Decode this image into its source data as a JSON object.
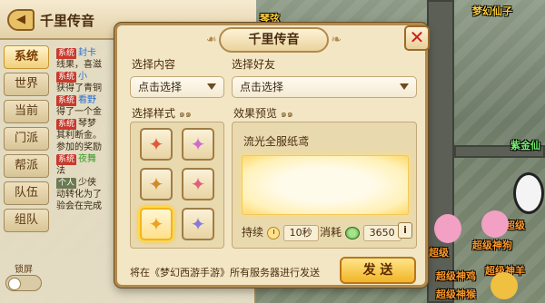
{
  "chat": {
    "title": "千里传音",
    "tabs": [
      "系统",
      "世界",
      "当前",
      "门派",
      "帮派",
      "队伍",
      "组队"
    ],
    "active_tab": 0,
    "lock_label": "锁屏",
    "messages": [
      {
        "channel": "系统",
        "name": "封卡",
        "text": ""
      },
      {
        "channel": "",
        "name": "",
        "text": "线果，喜滋"
      },
      {
        "channel": "系统",
        "name": "小",
        "text": ""
      },
      {
        "channel": "",
        "name": "",
        "text": "获得了青铜"
      },
      {
        "channel": "系统",
        "name": "看野",
        "text": ""
      },
      {
        "channel": "",
        "name": "",
        "text": "得了一个金"
      },
      {
        "channel": "系统",
        "name": "",
        "text": "琴梦"
      },
      {
        "channel": "",
        "name": "",
        "text": "其利断金。"
      },
      {
        "channel": "",
        "name": "",
        "text": "参加的奖励"
      },
      {
        "channel": "系统",
        "name": "夜舞",
        "text": ""
      },
      {
        "channel": "",
        "name": "",
        "text": "法"
      },
      {
        "channel": "个人",
        "name": "",
        "text": "少侠"
      },
      {
        "channel": "",
        "name": "",
        "text": "动转化为了"
      },
      {
        "channel": "",
        "name": "",
        "text": "验会在完成"
      }
    ]
  },
  "dialog": {
    "title": "千里传音",
    "select_content_label": "选择内容",
    "select_content_value": "点击选择",
    "select_friend_label": "选择好友",
    "select_friend_value": "点击选择",
    "select_style_label": "选择样式",
    "preview_label": "效果预览",
    "preview_text": "流光全服纸鸢",
    "duration_label": "持续",
    "duration_value": "10秒",
    "cost_label": "消耗",
    "cost_value": "3650",
    "info_label": "i",
    "footer_note": "将在《梦幻西游手游》所有服务器进行发送",
    "send_label": "发 送",
    "close_label": "✕",
    "styles": [
      {
        "glyph": "✦",
        "color": "#e05a3a"
      },
      {
        "glyph": "✦",
        "color": "#d06ad0"
      },
      {
        "glyph": "✦",
        "color": "#d08a2a"
      },
      {
        "glyph": "✦",
        "color": "#e0607a"
      },
      {
        "glyph": "✦",
        "color": "#f0a020"
      },
      {
        "glyph": "✦",
        "color": "#8a7ad8"
      }
    ],
    "selected_style": 4
  },
  "scene": {
    "labels": [
      {
        "text": "梦幻仙子",
        "color": "yellow"
      },
      {
        "text": "琴弦",
        "color": "yellow"
      },
      {
        "text": "紫金仙",
        "color": "green"
      },
      {
        "text": "超级",
        "color": "orange"
      },
      {
        "text": "超级神狗",
        "color": "orange"
      },
      {
        "text": "超级",
        "color": "orange"
      },
      {
        "text": "超级神羊",
        "color": "orange"
      },
      {
        "text": "超级神鸡",
        "color": "orange"
      },
      {
        "text": "超级神猴",
        "color": "orange"
      }
    ]
  }
}
